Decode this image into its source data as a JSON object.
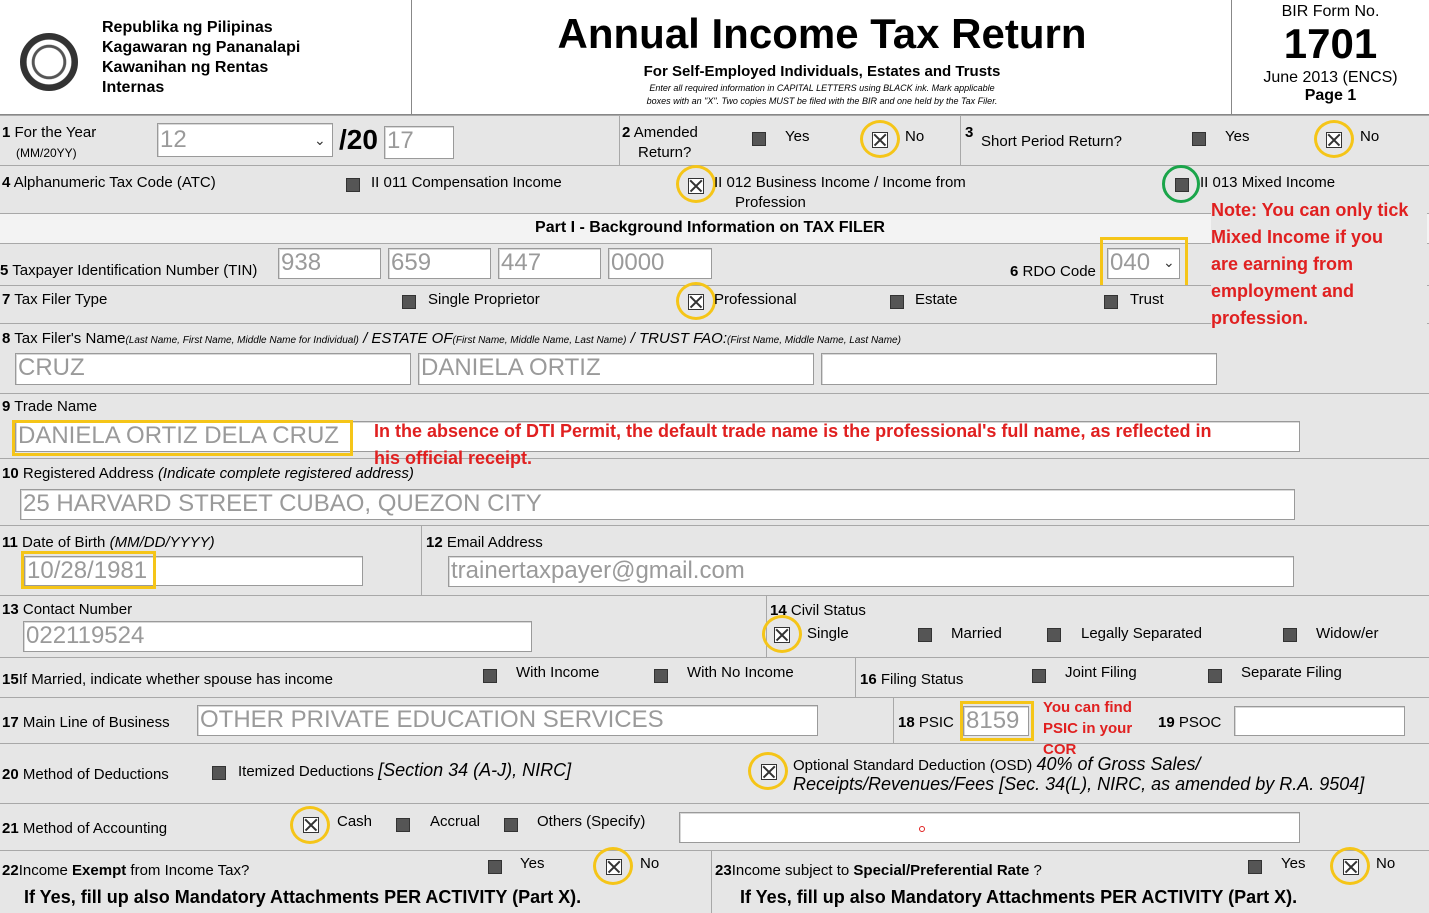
{
  "header": {
    "agency": [
      "Republika ng Pilipinas",
      "Kagawaran ng Pananalapi",
      "Kawanihan ng Rentas",
      "Internas"
    ],
    "title": "Annual Income Tax Return",
    "subtitle": "For Self-Employed Individuals, Estates and Trusts",
    "instruction_1": "Enter all required information in CAPITAL LETTERS using BLACK ink. Mark applicable",
    "instruction_2": "boxes with an \"X\". Two copies MUST be filed with the BIR and one held by the Tax Filer.",
    "form_no_label": "BIR Form No.",
    "form_no": "1701",
    "version": "June 2013 (ENCS)",
    "page": "Page 1"
  },
  "row1": {
    "num1": "1",
    "year_label": "For the Year",
    "year_hint": "(MM/20YY)",
    "month_value": "12",
    "year_prefix": "/20",
    "year_value": "17",
    "num2": "2",
    "amended_label_1": "Amended",
    "amended_label_2": "Return?",
    "yes": "Yes",
    "no": "No",
    "num3": "3",
    "short_label": "Short Period Return?"
  },
  "row4": {
    "num": "4",
    "label": "Alphanumeric Tax Code (ATC)",
    "opt1": "II 011 Compensation Income",
    "opt2_1": "II 012 Business Income / Income from",
    "opt2_2": "Profession",
    "opt3": "II 013 Mixed Income"
  },
  "part1": "Part I - Background Information on TAX FILER",
  "row5": {
    "num": "5",
    "label": "Taxpayer Identification Number (TIN)",
    "tin": [
      "938",
      "659",
      "447",
      "0000"
    ],
    "rdo_num": "6",
    "rdo_label": "RDO Code",
    "rdo_value": "040"
  },
  "row7": {
    "num": "7",
    "label": "Tax Filer Type",
    "opt1": "Single Proprietor",
    "opt2": "Professional",
    "opt3": "Estate",
    "opt4": "Trust"
  },
  "row8": {
    "num": "8",
    "label": "Tax Filer's Name",
    "hint1": "(Last Name, First Name, Middle Name for Individual)",
    "estate": "/ ESTATE OF",
    "hint2": "(First Name, Middle Name, Last Name)",
    "trust": "/ TRUST FAO:",
    "hint3": "(First Name, Middle Name, Last Name)",
    "last": "CRUZ",
    "first": "DANIELA ORTIZ",
    "third": ""
  },
  "row9": {
    "num": "9",
    "label": "Trade Name",
    "value": "DANIELA ORTIZ DELA CRUZ"
  },
  "row10": {
    "num": "10",
    "label": "Registered Address",
    "hint": "(Indicate complete registered address)",
    "value": "25 HARVARD STREET CUBAO, QUEZON CITY"
  },
  "row11": {
    "num": "11",
    "label": "Date of Birth",
    "hint": "(MM/DD/YYYY)",
    "value": "10/28/1981",
    "num12": "12",
    "email_label": "Email Address",
    "email": "trainertaxpayer@gmail.com"
  },
  "row13": {
    "num": "13",
    "label": "Contact Number",
    "value": "022119524",
    "num14": "14",
    "civil_label": "Civil Status",
    "opt1": "Single",
    "opt2": "Married",
    "opt3": "Legally Separated",
    "opt4": "Widow/er"
  },
  "row15": {
    "num": "15",
    "label": "If Married, indicate whether spouse has income",
    "opt1": "With Income",
    "opt2": "With No Income",
    "num16": "16",
    "filing_label": "Filing Status",
    "opt3": "Joint Filing",
    "opt4": "Separate Filing"
  },
  "row17": {
    "num": "17",
    "label": "Main Line of Business",
    "value": "OTHER PRIVATE EDUCATION SERVICES",
    "num18": "18",
    "psic_label": "PSIC",
    "psic": "8159",
    "num19": "19",
    "psoc_label": "PSOC",
    "psoc": ""
  },
  "row20": {
    "num": "20",
    "label": "Method of Deductions",
    "opt1": "Itemized Deductions",
    "opt1_ref": "[Section 34 (A-J), NIRC]",
    "opt2": "Optional Standard Deduction (OSD)",
    "opt2_pct": "40% of Gross Sales/",
    "opt2_ref": "Receipts/Revenues/Fees [Sec. 34(L), NIRC, as amended by R.A. 9504]"
  },
  "row21": {
    "num": "21",
    "label": "Method of Accounting",
    "opt1": "Cash",
    "opt2": "Accrual",
    "opt3": "Others (Specify)",
    "other": ""
  },
  "row22": {
    "num": "22",
    "label_pre": "Income ",
    "label_bold": "Exempt",
    "label_post": " from Income Tax?",
    "note": "If Yes, fill up also Mandatory Attachments PER ACTIVITY (Part X).",
    "num23": "23",
    "label23_pre": "Income subject to ",
    "label23_bold": "Special/Preferential Rate",
    "label23_post": " ?"
  },
  "notes": {
    "mixed": [
      "Note: You can only tick",
      "Mixed Income if you",
      "are earning from",
      "employment and",
      "profession."
    ],
    "trade": "In the absence of DTI Permit, the default trade name is the professional's full name, as reflected in",
    "trade2": "his official receipt.",
    "psic": [
      "You can find",
      "PSIC in your",
      "COR"
    ]
  },
  "colors": {
    "annotation_ring": "#f5c518",
    "annotation_ring_green": "#1aa54a",
    "note_text": "#e02020"
  }
}
